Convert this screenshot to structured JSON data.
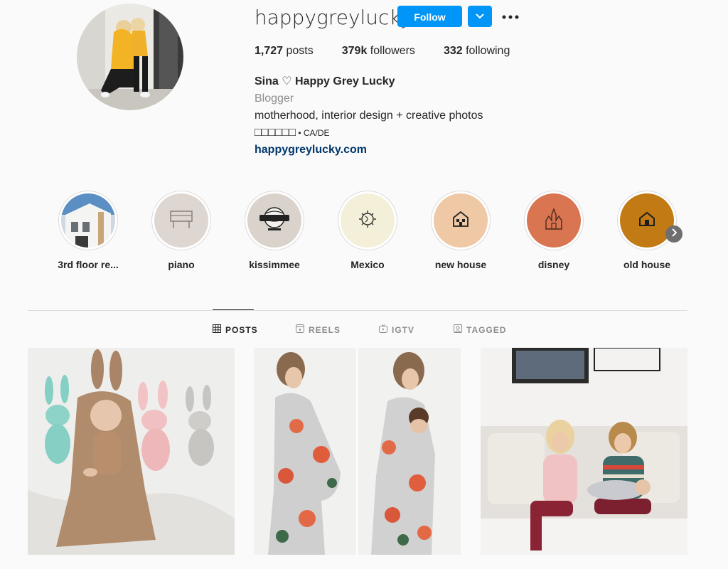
{
  "profile": {
    "username": "happygreylucky",
    "follow_label": "Follow",
    "posts_count": "1,727",
    "posts_label": "posts",
    "followers_count": "379k",
    "followers_label": "followers",
    "following_count": "332",
    "following_label": "following",
    "full_name": "Sina ♡ Happy Grey Lucky",
    "category": "Blogger",
    "bio_line1": "motherhood, interior design + creative photos",
    "bio_flags": "□□□□□□",
    "bio_location": " • CA/DE",
    "website": "happygreylucky.com"
  },
  "highlights": [
    {
      "label": "3rd floor re...",
      "icon": "house-photo"
    },
    {
      "label": "piano",
      "icon": "piano-icon",
      "bg": "#ddd6d1"
    },
    {
      "label": "kissimmee",
      "icon": "universal-globe-icon",
      "bg": "#d9d3cc"
    },
    {
      "label": "Mexico",
      "icon": "sun-moon-icon",
      "bg": "#f3efd8"
    },
    {
      "label": "new house",
      "icon": "house-icon",
      "bg": "#efc9a6"
    },
    {
      "label": "disney",
      "icon": "castle-icon",
      "bg": "#d97551"
    },
    {
      "label": "old house",
      "icon": "house-icon",
      "bg": "#c17a14"
    }
  ],
  "tabs": [
    {
      "label": "POSTS",
      "icon": "grid-icon",
      "active": true
    },
    {
      "label": "REELS",
      "icon": "reels-icon"
    },
    {
      "label": "IGTV",
      "icon": "igtv-icon"
    },
    {
      "label": "TAGGED",
      "icon": "tagged-icon"
    }
  ],
  "colors": {
    "accent": "#0095f6",
    "link": "#00376b",
    "muted": "#8e8e8e"
  }
}
